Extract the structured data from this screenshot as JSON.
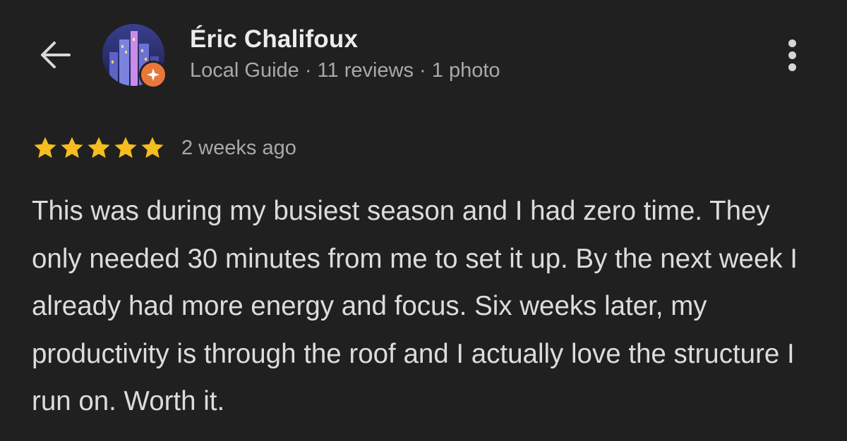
{
  "header": {
    "back_icon": "arrow-left-icon",
    "reviewer": {
      "name": "Éric Chalifoux",
      "meta": "Local Guide · 11 reviews · 1 photo",
      "badge_icon": "local-guide-badge-icon",
      "avatar_icon": "city-skyline-avatar"
    },
    "more_icon": "more-vertical-icon"
  },
  "review": {
    "rating": 5,
    "rating_max": 5,
    "date": "2 weeks ago",
    "text": "This was during my busiest season and I had zero time. They only needed 30 minutes from me to set it up. By the next week I already had more energy and focus. Six weeks later, my productivity is through the roof and I actually love the structure I run on. Worth it."
  },
  "colors": {
    "background": "#202020",
    "star": "#f5bd1f",
    "badge": "#e8773a",
    "primary_text": "#ececec",
    "secondary_text": "#a9a9a9"
  }
}
